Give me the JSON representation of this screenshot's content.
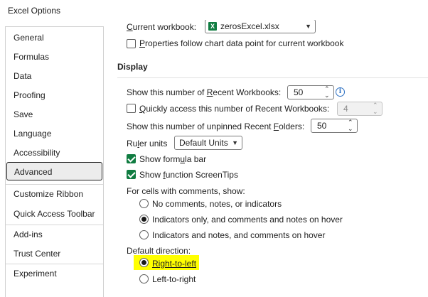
{
  "window": {
    "title": "Excel Options"
  },
  "nav": {
    "items": [
      {
        "label": "General"
      },
      {
        "label": "Formulas"
      },
      {
        "label": "Data"
      },
      {
        "label": "Proofing"
      },
      {
        "label": "Save"
      },
      {
        "label": "Language"
      },
      {
        "label": "Accessibility"
      },
      {
        "label": "Advanced",
        "selected": true
      },
      {
        "label": "Customize Ribbon"
      },
      {
        "label": "Quick Access Toolbar"
      },
      {
        "label": "Add-ins"
      },
      {
        "label": "Trust Center"
      },
      {
        "label": "Experiment"
      }
    ]
  },
  "chart_options": {
    "current_workbook_label_pre": "C",
    "current_workbook_label_rest": "urrent workbook:",
    "current_workbook_value": "zerosExcel.xlsx",
    "properties_follow_pre": "P",
    "properties_follow_rest": "roperties follow chart data point for current workbook",
    "properties_follow_checked": false
  },
  "display": {
    "heading": "Display",
    "recent_workbooks_pre": "Show this number of ",
    "recent_workbooks_ul": "R",
    "recent_workbooks_post": "ecent Workbooks:",
    "recent_workbooks_value": "50",
    "quick_access_ul": "Q",
    "quick_access_rest": "uickly access this number of Recent Workbooks:",
    "quick_access_checked": false,
    "quick_access_value": "4",
    "unpinned_pre": "Show this number of unpinned Recent ",
    "unpinned_ul": "F",
    "unpinned_post": "olders:",
    "unpinned_value": "50",
    "ruler_pre": "Ru",
    "ruler_ul": "l",
    "ruler_post": "er units",
    "ruler_value": "Default Units",
    "formula_bar_pre": "Show form",
    "formula_bar_ul": "u",
    "formula_bar_post": "la bar",
    "formula_bar_checked": true,
    "screentips_pre": "Show ",
    "screentips_ul": "f",
    "screentips_post": "unction ScreenTips",
    "screentips_checked": true,
    "comments_label": "For cells with comments, show:",
    "comments_options": [
      {
        "label": "No comments, notes, or indicators",
        "selected": false
      },
      {
        "label": "Indicators only, and comments and notes on hover",
        "selected": true
      },
      {
        "label": "Indicators and notes, and comments on hover",
        "selected": false
      }
    ],
    "direction_label": "Default direction:",
    "direction_options": [
      {
        "label": "Right-to-left",
        "selected": true,
        "highlighted": true
      },
      {
        "label": "Left-to-right",
        "selected": false
      }
    ]
  },
  "colors": {
    "accent_green": "#107c41",
    "highlight": "#ffff00",
    "info_blue": "#2b6fc2"
  }
}
